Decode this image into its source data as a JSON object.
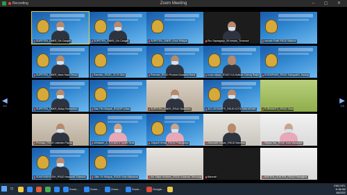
{
  "window": {
    "title": "Zoom Meeting",
    "recording_label": "Recording",
    "controls": "–  ▢  ✕"
  },
  "pagination": {
    "left_arrow": "◀",
    "right_arrow": "▶",
    "left_page": "1/3",
    "right_page": "1/3"
  },
  "participants": [
    {
      "name": "SUPETEN_DMKR_Sio Cangkir",
      "bg": "blue",
      "person": "masked",
      "active": true
    },
    {
      "name": "SUPETEN_DMKR_Oni Cangkir",
      "bg": "blue",
      "person": "masked"
    },
    {
      "name": "SUPETEN_DMKR_Kusri Hidayat",
      "bg": "blue",
      "person": "none"
    },
    {
      "name": "Eko Sapsagayo_Wi cesaro_Tmswadi",
      "bg": "dark",
      "person": "masked"
    },
    {
      "name": "meutah Rafki RSUD Makmur",
      "bg": "blue",
      "person": "none"
    },
    {
      "name": "SUPETEN_DMKR_Nara Hasil Gesun",
      "bg": "blue",
      "person": "masked"
    },
    {
      "name": "Ramdan_RSUD_Ch Dr Mus",
      "bg": "blue",
      "person": "none"
    },
    {
      "name": "Rahmad_RSUD Provinsi Sulawesi Barat",
      "bg": "blue",
      "person": "masked"
    },
    {
      "name": "surya wijaya_RSUD H.A.Sulthan Daeng Radja",
      "bg": "blue",
      "person": "face"
    },
    {
      "name": "KUSARWAN_RSUD Kabupaten Jepang",
      "bg": "blue",
      "person": "none"
    },
    {
      "name": "SUPETEN_DMKR_Mulyo Ramadhan",
      "bg": "blue",
      "person": "masked"
    },
    {
      "name": "Dian Fitri Mulyati_RSUDP Lintas",
      "bg": "blue",
      "person": "none"
    },
    {
      "name": "SUPETEN_DMKR_RSUD Butahlam",
      "bg": "room",
      "person": "masked"
    },
    {
      "name": "ADI UDYAMPITI_RSUD KOTA MAKASSAR",
      "bg": "blue",
      "person": "masked"
    },
    {
      "name": "FURWANTO_RSUD Sisal",
      "bg": "green",
      "person": "none"
    },
    {
      "name": "Purbaya_RSUD Labuhan Papua",
      "bg": "room",
      "person": "masked"
    },
    {
      "name": "mintawan_A_H.B.BAYU Syafril Sinai",
      "bg": "blue",
      "person": "hijab"
    },
    {
      "name": "Juliyanti ismail_RSUD Pelangkayo",
      "bg": "blue",
      "person": "hijab"
    },
    {
      "name": "Zainuddin Hasan_RSUD Mamasa",
      "bg": "room2",
      "person": "face"
    },
    {
      "name": "Wijaya Har_RSUD Kota Makassar",
      "bg": "white",
      "person": "hijab"
    },
    {
      "name": "SUMIYANINGSIH_RSUD Hawarisil Sulawesi",
      "bg": "blue",
      "person": "masked"
    },
    {
      "name": "Lilian Sri Hidayat_RSUD Kota Makassar",
      "bg": "blue",
      "person": "none"
    },
    {
      "name": "Ani Salsa Hertanto_RSUD Kotamas Teknologi",
      "bg": "room2",
      "person": "none"
    },
    {
      "name": "Bahmah",
      "bg": "dark",
      "person": "none"
    },
    {
      "name": "BASTEN_DOKTER_RSUD Pankajene",
      "bg": "white",
      "person": "none"
    }
  ],
  "taskbar": {
    "start": "⊞",
    "search": "○",
    "items": [
      {
        "label": "",
        "color": "#f0c94a"
      },
      {
        "label": "",
        "color": "#2d8cff"
      },
      {
        "label": "",
        "color": "#e25b3a"
      },
      {
        "label": "",
        "color": "#4caf50"
      },
      {
        "label": "",
        "color": "#2d8cff"
      },
      {
        "label": "Zoom...",
        "color": "#2d8cff"
      },
      {
        "label": "Zoom...",
        "color": "#2d8cff"
      },
      {
        "label": "Zoom...",
        "color": "#2d8cff"
      },
      {
        "label": "Zoom...",
        "color": "#2d8cff"
      },
      {
        "label": "Google...",
        "color": "#e04a3a"
      },
      {
        "label": "",
        "color": "#f0c94a"
      }
    ],
    "tray_lang": "ENG INTL",
    "tray_time": "11:56 AM",
    "tray_date": "4/8/2022"
  }
}
